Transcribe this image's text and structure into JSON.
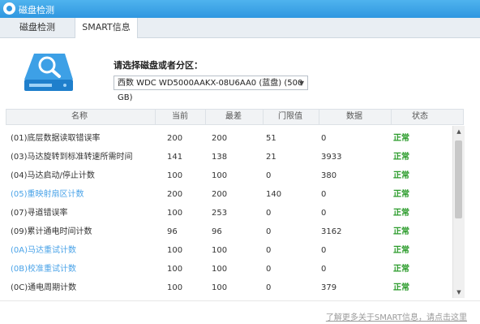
{
  "window": {
    "title": "磁盘检测"
  },
  "tabs": [
    {
      "label": "磁盘检测"
    },
    {
      "label": "SMART信息"
    }
  ],
  "disk_select": {
    "prompt": "请选择磁盘或者分区：",
    "selected": "西数 WDC WD5000AAKX-08U6AA0 (蓝盘) (500 GB)"
  },
  "table": {
    "headers": [
      "名称",
      "当前",
      "最差",
      "门限值",
      "数据",
      "状态"
    ],
    "rows": [
      {
        "name": "(01)底层数据读取错误率",
        "current": "200",
        "worst": "200",
        "threshold": "51",
        "data": "0",
        "status": "正常",
        "link": false
      },
      {
        "name": "(03)马达旋转到标准转速所需时间",
        "current": "141",
        "worst": "138",
        "threshold": "21",
        "data": "3933",
        "status": "正常",
        "link": false
      },
      {
        "name": "(04)马达启动/停止计数",
        "current": "100",
        "worst": "100",
        "threshold": "0",
        "data": "380",
        "status": "正常",
        "link": false
      },
      {
        "name": "(05)重映射扇区计数",
        "current": "200",
        "worst": "200",
        "threshold": "140",
        "data": "0",
        "status": "正常",
        "link": true
      },
      {
        "name": "(07)寻道错误率",
        "current": "100",
        "worst": "253",
        "threshold": "0",
        "data": "0",
        "status": "正常",
        "link": false
      },
      {
        "name": "(09)累计通电时间计数",
        "current": "96",
        "worst": "96",
        "threshold": "0",
        "data": "3162",
        "status": "正常",
        "link": false
      },
      {
        "name": "(0A)马达重试计数",
        "current": "100",
        "worst": "100",
        "threshold": "0",
        "data": "0",
        "status": "正常",
        "link": true
      },
      {
        "name": "(0B)校准重试计数",
        "current": "100",
        "worst": "100",
        "threshold": "0",
        "data": "0",
        "status": "正常",
        "link": true
      },
      {
        "name": "(0C)通电周期计数",
        "current": "100",
        "worst": "100",
        "threshold": "0",
        "data": "379",
        "status": "正常",
        "link": false
      }
    ]
  },
  "footer": {
    "link": "了解更多关于SMART信息，请点击这里"
  },
  "colors": {
    "title_bar": "#2f97e0",
    "status_ok": "#2a9b2a",
    "link": "#4aa3e8"
  },
  "icons": {
    "app": "app-icon",
    "disk": "disk-search-icon",
    "dropdown": "chevron-down-icon"
  }
}
